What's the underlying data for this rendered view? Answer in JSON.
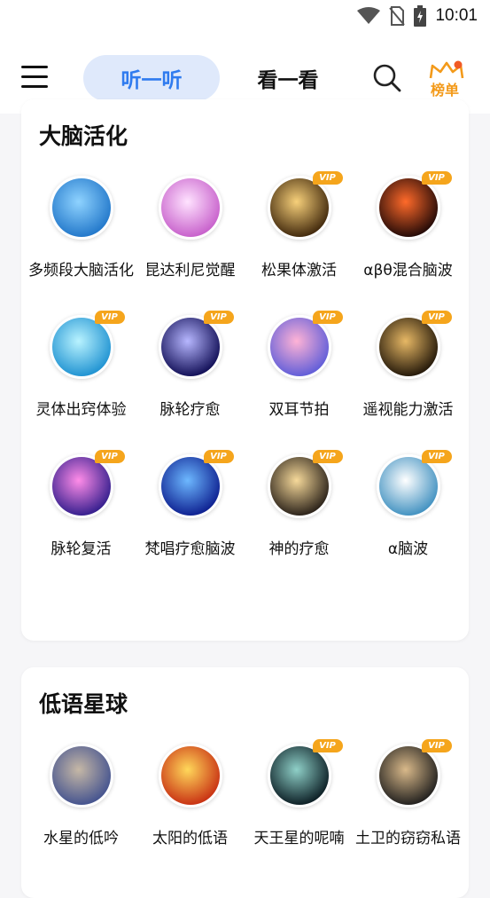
{
  "status": {
    "time": "10:01"
  },
  "header": {
    "tab_listen": "听一听",
    "tab_watch": "看一看",
    "rank_label": "榜单"
  },
  "section1": {
    "title": "大脑活化",
    "items": [
      {
        "label": "多频段大脑活化",
        "vip": false,
        "colors": [
          "#8fd3ff",
          "#1e74c8"
        ]
      },
      {
        "label": "昆达利尼觉醒",
        "vip": false,
        "colors": [
          "#ffe3ff",
          "#c55bc9"
        ]
      },
      {
        "label": "松果体激活",
        "vip": true,
        "colors": [
          "#f7d07a",
          "#3a2208"
        ]
      },
      {
        "label": "αβθ混合脑波",
        "vip": true,
        "colors": [
          "#ff6a2a",
          "#1a0606"
        ]
      },
      {
        "label": "灵体出窍体验",
        "vip": true,
        "colors": [
          "#b9f3ff",
          "#1a8fd0"
        ]
      },
      {
        "label": "脉轮疗愈",
        "vip": true,
        "colors": [
          "#b7b7ff",
          "#0b0850"
        ]
      },
      {
        "label": "双耳节拍",
        "vip": true,
        "colors": [
          "#ffb3d6",
          "#5a5ad8"
        ]
      },
      {
        "label": "遥视能力激活",
        "vip": true,
        "colors": [
          "#e7b865",
          "#1c1206"
        ]
      },
      {
        "label": "脉轮复活",
        "vip": true,
        "colors": [
          "#ff8ce8",
          "#2c1a8a"
        ]
      },
      {
        "label": "梵唱疗愈脑波",
        "vip": true,
        "colors": [
          "#6db8ff",
          "#0a1a8c"
        ]
      },
      {
        "label": "神的疗愈",
        "vip": true,
        "colors": [
          "#f6d99a",
          "#221a14"
        ]
      },
      {
        "label": "α脑波",
        "vip": true,
        "colors": [
          "#ffffff",
          "#3a8dbe"
        ]
      }
    ]
  },
  "section2": {
    "title": "低语星球",
    "items": [
      {
        "label": "水星的低吟",
        "vip": false,
        "colors": [
          "#c6b8a6",
          "#3f4f8e"
        ]
      },
      {
        "label": "太阳的低语",
        "vip": false,
        "colors": [
          "#ffd85a",
          "#c62a10"
        ]
      },
      {
        "label": "天王星的呢喃",
        "vip": true,
        "colors": [
          "#8fd0c8",
          "#07171e"
        ]
      },
      {
        "label": "土卫的窃窃私语",
        "vip": true,
        "colors": [
          "#d9b98a",
          "#1a1a1a"
        ]
      }
    ]
  },
  "vip_badge_text": "VIP"
}
